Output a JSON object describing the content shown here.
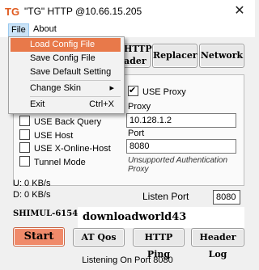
{
  "window": {
    "title": "\"TG\" HTTP @10.66.15.205",
    "close_glyph": "✕"
  },
  "menubar": {
    "file": "File",
    "about": "About"
  },
  "file_menu": {
    "items": [
      {
        "label": "Load Config File"
      },
      {
        "label": "Save Config File"
      },
      {
        "label": "Save Default Setting"
      },
      {
        "label": "Change Skin",
        "submenu_arrow": "▸"
      },
      {
        "label": "Exit",
        "shortcut": "Ctrl+X"
      }
    ],
    "highlighted_index": 0
  },
  "toolbar": {
    "http_header_partial": "HTTP",
    "http_header_partial2": "ader",
    "replacer": "Replacer",
    "network": "Network"
  },
  "options": {
    "use_back_query": "USE Back Query",
    "use_host": "USE Host",
    "use_x_online_host": "USE X-Online-Host",
    "tunnel_mode": "Tunnel Mode"
  },
  "proxy": {
    "use_proxy_label": "USE Proxy",
    "use_proxy_checked": true,
    "proxy_label": "Proxy",
    "proxy_value": "10.128.1.2",
    "port_label": "Port",
    "port_value": "8080",
    "auth_note": "Unsupported Authentication Proxy"
  },
  "traffic": {
    "upload": "U:  0 KB/s",
    "download": "D:  0 KB/s"
  },
  "listen": {
    "label": "Listen Port",
    "value": "8080"
  },
  "branding": {
    "author": "SHIMUL-615458",
    "watermark": "downloadworld43"
  },
  "buttons": {
    "start": "Start",
    "at_qos": "AT Qos",
    "http_ping": "HTTP Ping",
    "header_log": "Header Log"
  },
  "status": {
    "text": "Listening On Port 8080"
  },
  "colors": {
    "accent_orange": "#e8794a",
    "menu_highlight": "#e8794a",
    "start_bg": "#f08a6a"
  }
}
